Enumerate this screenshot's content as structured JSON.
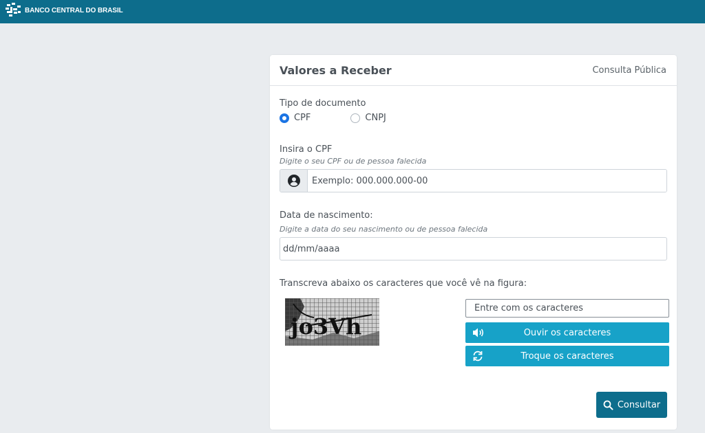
{
  "header": {
    "brand": "BANCO CENTRAL DO BRASIL",
    "logo_icon": "bcb-logo-icon",
    "background_color": "#0d6d8c"
  },
  "card": {
    "title": "Valores a Receber",
    "subtitle": "Consulta Pública"
  },
  "document_type": {
    "label": "Tipo de documento",
    "options": [
      {
        "label": "CPF",
        "selected": true
      },
      {
        "label": "CNPJ",
        "selected": false
      }
    ]
  },
  "cpf": {
    "label": "Insira o CPF",
    "hint": "Digite o seu CPF ou de pessoa falecida",
    "placeholder": "Exemplo: 000.000.000-00",
    "icon": "user-circle-icon"
  },
  "birth_date": {
    "label": "Data de nascimento:",
    "hint": "Digite a data do seu nascimento ou de pessoa falecida",
    "placeholder": "dd/mm/aaaa"
  },
  "captcha": {
    "instruction": "Transcreva abaixo os caracteres que você vê na figura:",
    "image_text": "jo3Vh",
    "input_placeholder": "Entre com os caracteres",
    "listen_label": "Ouvir os caracteres",
    "listen_icon": "speaker-icon",
    "change_label": "Troque os caracteres",
    "change_icon": "refresh-icon"
  },
  "submit": {
    "label": "Consultar",
    "icon": "search-icon"
  },
  "colors": {
    "primary": "#0d6d8c",
    "info": "#17a2c8",
    "radio_selected": "#1b74e4",
    "page_background": "#e9ecef"
  }
}
